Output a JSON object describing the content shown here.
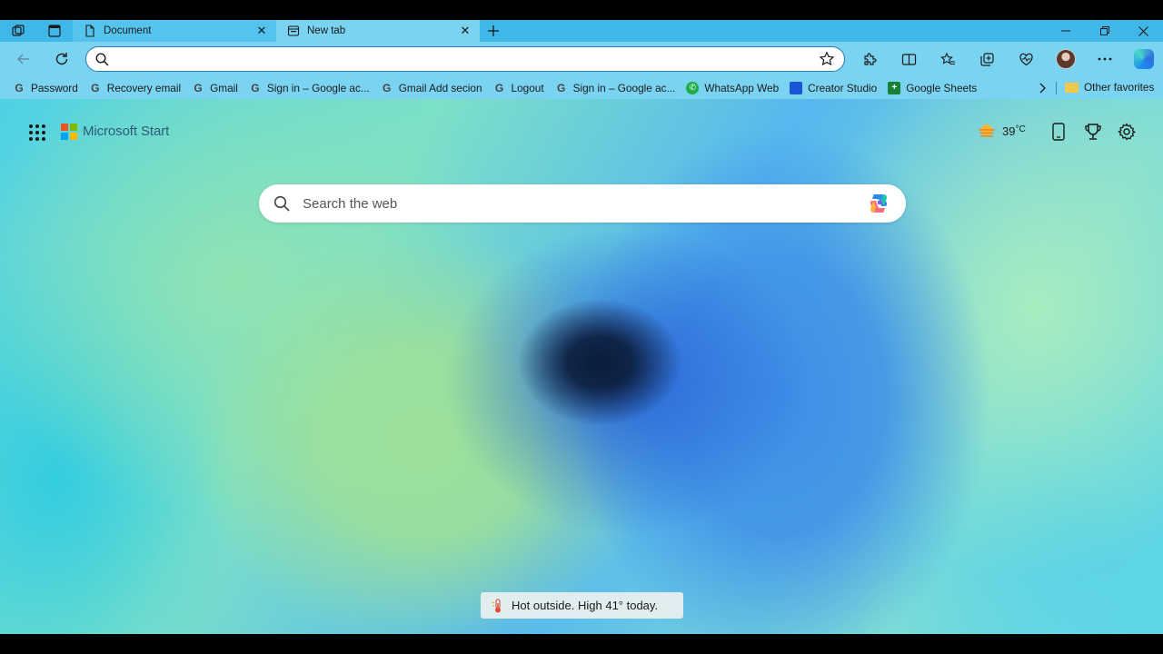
{
  "tabs": [
    {
      "title": "Document",
      "active": false
    },
    {
      "title": "New tab",
      "active": true
    }
  ],
  "toolbar": {
    "address_value": "",
    "address_placeholder": ""
  },
  "bookmarks": [
    {
      "label": "Password",
      "icon": "google-icon"
    },
    {
      "label": "Recovery email",
      "icon": "google-icon"
    },
    {
      "label": "Gmail",
      "icon": "google-icon"
    },
    {
      "label": "Sign in – Google ac...",
      "icon": "google-icon"
    },
    {
      "label": "Gmail Add secion",
      "icon": "google-icon"
    },
    {
      "label": "Logout",
      "icon": "google-icon"
    },
    {
      "label": "Sign in – Google ac...",
      "icon": "google-icon"
    },
    {
      "label": "WhatsApp Web",
      "icon": "whatsapp-icon"
    },
    {
      "label": "Creator Studio",
      "icon": "creator-studio-icon"
    },
    {
      "label": "Google Sheets",
      "icon": "google-sheets-icon"
    }
  ],
  "other_favorites": "Other favorites",
  "newtab": {
    "brand": "Microsoft Start",
    "temperature": "39",
    "temperature_unit": "°C",
    "search_placeholder": "Search the web",
    "toast": "Hot outside. High 41° today."
  },
  "colors": {
    "tabstrip": "#3fb7e8",
    "toolbar": "#7ad3f1",
    "accent": "#2b7ab0"
  }
}
